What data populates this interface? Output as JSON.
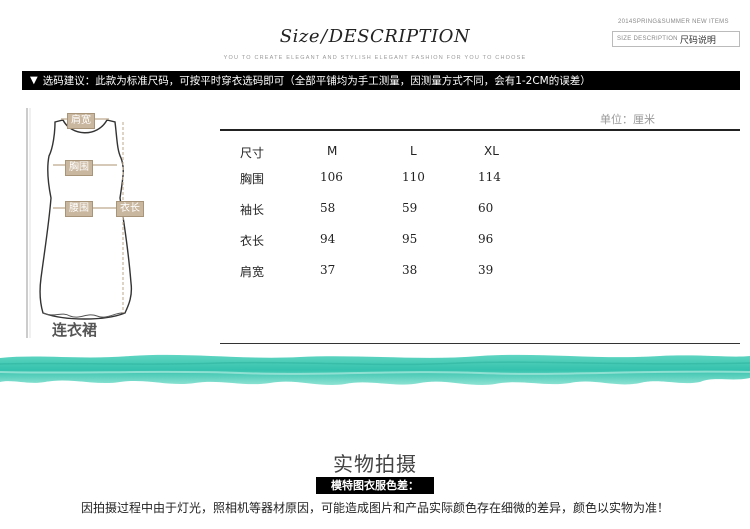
{
  "header": {
    "title_script": "Size",
    "title_sep": "/",
    "title_main": "DESCRIPTION",
    "tagline": "YOU TO CREATE ELEGANT AND STYLISH ELEGANT FASHION FOR YOU TO CHOOSE",
    "corner_line1": "2014SPRING&SUMMER NEW ITEMS",
    "corner_line2_en": "SIZE DESCRIPTION",
    "corner_line2_zh": "尺码说明"
  },
  "notice": {
    "arrow": "▼",
    "text": "选码建议：此款为标准尺码，可按平时穿衣选码即可（全部平铺均为手工测量，因测量方式不同，会有1-2CM的误差）"
  },
  "figure": {
    "labels": {
      "shoulder": "肩宽",
      "chest": "胸围",
      "waist": "腰围",
      "length": "衣长"
    },
    "caption": "连衣裙"
  },
  "size_table": {
    "unit": "单位：厘米",
    "header_label": "尺寸",
    "sizes": [
      "M",
      "L",
      "XL"
    ],
    "rows": [
      {
        "label": "胸围",
        "values": [
          "106",
          "110",
          "114"
        ]
      },
      {
        "label": "袖长",
        "values": [
          "58",
          "59",
          "60"
        ]
      },
      {
        "label": "衣长",
        "values": [
          "94",
          "95",
          "96"
        ]
      },
      {
        "label": "肩宽",
        "values": [
          "37",
          "38",
          "39"
        ]
      }
    ]
  },
  "photo_section": {
    "title": "实物拍摄",
    "subtitle": "模特图衣服色差：",
    "note": "因拍摄过程中由于灯光，照相机等器材原因，可能造成图片和产品实际颜色存在细微的差异，颜色以实物为准！"
  },
  "colors": {
    "band_teal": "#3ec8b4",
    "notice_bg": "#000000",
    "tag_bg": "#c9b79f"
  }
}
